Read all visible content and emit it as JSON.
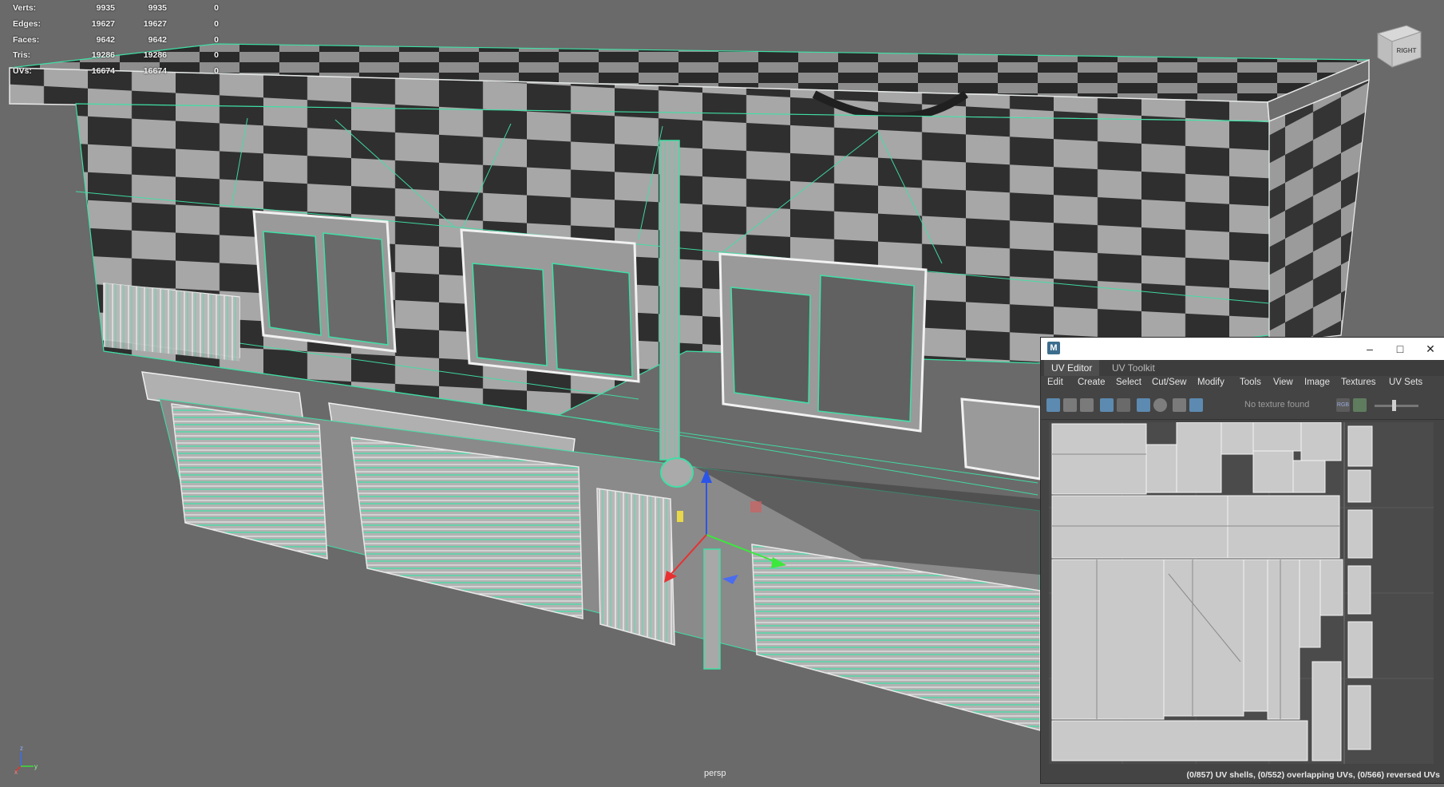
{
  "hud": {
    "rows": [
      {
        "label": "Verts:",
        "a": "9935",
        "b": "9935",
        "c": "0"
      },
      {
        "label": "Edges:",
        "a": "19627",
        "b": "19627",
        "c": "0"
      },
      {
        "label": "Faces:",
        "a": "9642",
        "b": "9642",
        "c": "0"
      },
      {
        "label": "Tris:",
        "a": "19286",
        "b": "19286",
        "c": "0"
      },
      {
        "label": "UVs:",
        "a": "16674",
        "b": "16674",
        "c": "0"
      }
    ]
  },
  "viewport": {
    "camera_label": "persp",
    "viewcube_label": "RIGHT",
    "axis_x": "x",
    "axis_y": "y",
    "axis_z": "z"
  },
  "colors": {
    "background": "#6a6a6a",
    "wire": "#3fe0a6",
    "check_light": "#a8a8a8",
    "check_dark": "#2e2e2e",
    "uv_bg": "#444444",
    "active_button": "#5d8ab0"
  },
  "uv_editor": {
    "app_icon": "M",
    "tabs": [
      "UV Editor",
      "UV Toolkit"
    ],
    "menu": [
      "Edit",
      "Create",
      "Select",
      "Cut/Sew",
      "Modify",
      "Tools",
      "View",
      "Image",
      "Textures",
      "UV Sets"
    ],
    "texture_status": "No texture found",
    "rgb_label": "RGB",
    "status": "(0/857) UV shells, (0/552) overlapping UVs, (0/566) reversed UVs",
    "window_buttons": [
      "minimize-icon",
      "maximize-icon",
      "close-icon"
    ]
  }
}
